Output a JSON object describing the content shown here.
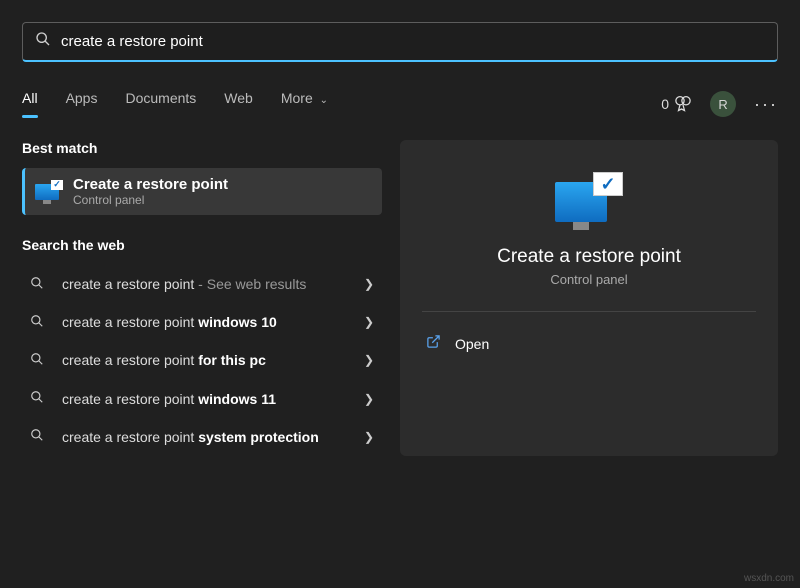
{
  "search": {
    "value": "create a restore point"
  },
  "tabs": {
    "all": "All",
    "apps": "Apps",
    "documents": "Documents",
    "web": "Web",
    "more": "More"
  },
  "header": {
    "points": "0",
    "initial": "R"
  },
  "best_match": {
    "heading": "Best match",
    "title": "Create a restore point",
    "subtitle": "Control panel"
  },
  "web": {
    "heading": "Search the web",
    "items": [
      {
        "prefix": "create a restore point",
        "bold": "",
        "suffix": " - See web results"
      },
      {
        "prefix": "create a restore point ",
        "bold": "windows 10",
        "suffix": ""
      },
      {
        "prefix": "create a restore point ",
        "bold": "for this pc",
        "suffix": ""
      },
      {
        "prefix": "create a restore point ",
        "bold": "windows 11",
        "suffix": ""
      },
      {
        "prefix": "create a restore point ",
        "bold": "system protection",
        "suffix": ""
      }
    ]
  },
  "panel": {
    "title": "Create a restore point",
    "subtitle": "Control panel",
    "open": "Open"
  },
  "watermark": "wsxdn.com"
}
